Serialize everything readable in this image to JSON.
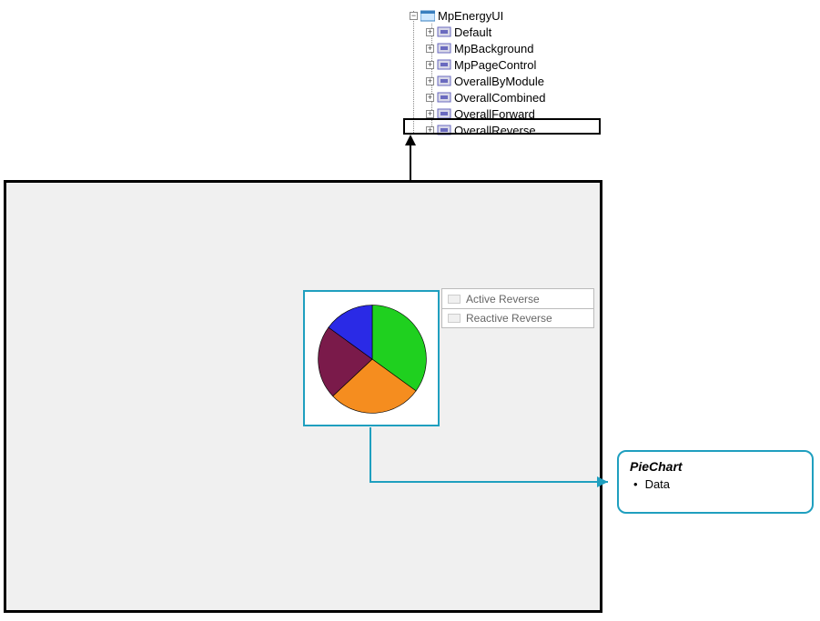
{
  "tree": {
    "root": {
      "label": "MpEnergyUI"
    },
    "children": [
      {
        "label": "Default"
      },
      {
        "label": "MpBackground"
      },
      {
        "label": "MpPageControl"
      },
      {
        "label": "OverallByModule"
      },
      {
        "label": "OverallCombined"
      },
      {
        "label": "OverallForward"
      },
      {
        "label": "OverallReverse"
      }
    ]
  },
  "legend": {
    "items": [
      {
        "label": "Active Reverse"
      },
      {
        "label": "Reactive Reverse"
      }
    ]
  },
  "callout": {
    "title": "PieChart",
    "item": "Data"
  },
  "chart_data": {
    "type": "pie",
    "title": "",
    "slices": [
      {
        "name": "green",
        "value": 35,
        "color": "#1fd01f"
      },
      {
        "name": "orange",
        "value": 28,
        "color": "#f58d1f"
      },
      {
        "name": "maroon",
        "value": 22,
        "color": "#7a1a4a"
      },
      {
        "name": "blue",
        "value": 15,
        "color": "#2a2ae6"
      }
    ]
  }
}
